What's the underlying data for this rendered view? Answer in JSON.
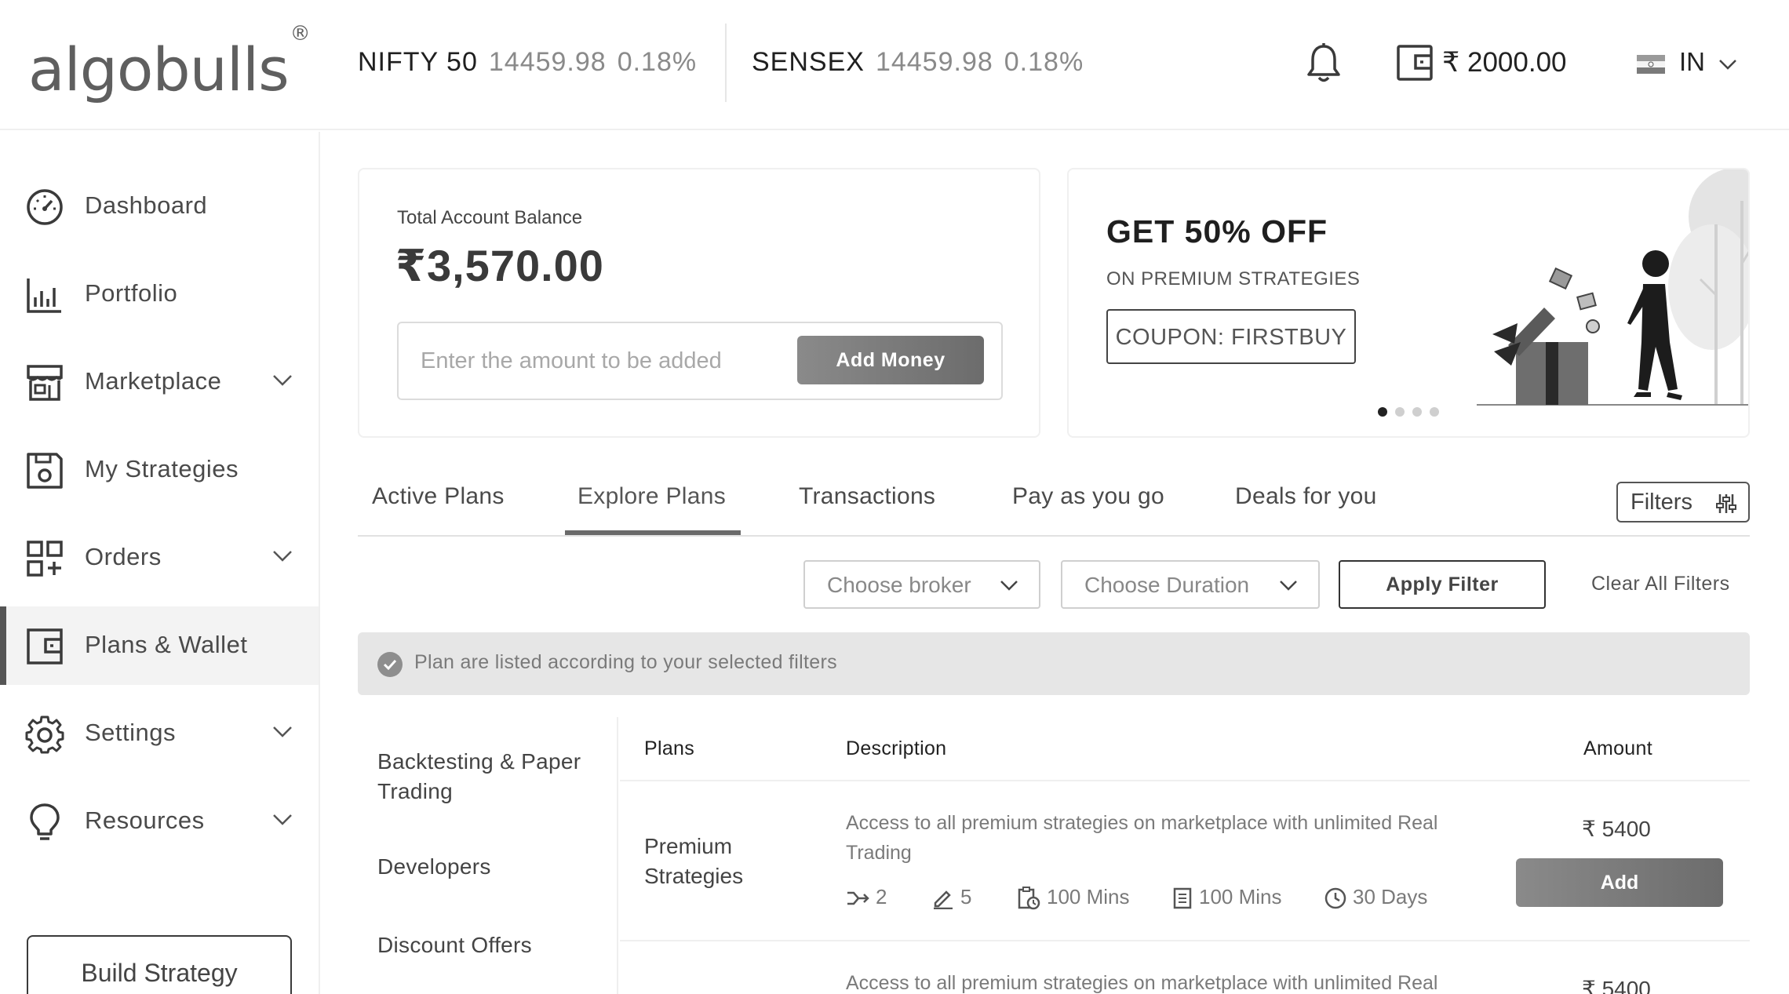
{
  "header": {
    "logo_text": "algobulls",
    "logo_mark": "®",
    "tickers": [
      {
        "name": "NIFTY 50",
        "value": "14459.98",
        "change": "0.18%"
      },
      {
        "name": "SENSEX",
        "value": "14459.98",
        "change": "0.18%"
      }
    ],
    "notification_icon": "bell-icon",
    "wallet_icon": "wallet-icon",
    "wallet_amount": "₹ 2000.00",
    "country_code": "IN"
  },
  "sidebar": {
    "items": [
      {
        "label": "Dashboard",
        "icon": "speedometer-icon"
      },
      {
        "label": "Portfolio",
        "icon": "bar-chart-icon"
      },
      {
        "label": "Marketplace",
        "icon": "store-icon"
      },
      {
        "label": "My Strategies",
        "icon": "save-icon"
      },
      {
        "label": "Orders",
        "icon": "grid-plus-icon"
      },
      {
        "label": "Plans & Wallet",
        "icon": "wallet-icon"
      },
      {
        "label": "Settings",
        "icon": "gear-icon"
      },
      {
        "label": "Resources",
        "icon": "lightbulb-icon"
      }
    ],
    "active_item": "Plans & Wallet",
    "build_button": "Build Strategy"
  },
  "balance_card": {
    "label": "Total Account Balance",
    "value": "₹3,570.00",
    "input_placeholder": "Enter the amount to be added",
    "add_button": "Add Money"
  },
  "promo_card": {
    "title": "GET 50% OFF",
    "subtitle": "ON PREMIUM STRATEGIES",
    "coupon": "COUPON: FIRSTBUY",
    "slide_count": 4,
    "active_slide": 1
  },
  "tabs": {
    "items": [
      "Active Plans",
      "Explore Plans",
      "Transactions",
      "Pay as you go",
      "Deals for you"
    ],
    "active": "Explore Plans",
    "filters_button": "Filters"
  },
  "filters": {
    "broker_placeholder": "Choose broker",
    "duration_placeholder": "Choose Duration",
    "apply_button": "Apply Filter",
    "clear_link": "Clear All Filters",
    "info_message": "Plan are listed according to your selected filters"
  },
  "categories": [
    "Backtesting & Paper Trading",
    "Developers",
    "Discount Offers"
  ],
  "table": {
    "headers": {
      "plans": "Plans",
      "description": "Description",
      "amount": "Amount"
    },
    "rows": [
      {
        "plan": "Premium Strategies",
        "description": "Access to all premium strategies on marketplace with unlimited Real Trading",
        "meta": [
          "2",
          "5",
          "100 Mins",
          "100 Mins",
          "30 Days"
        ],
        "amount": "₹ 5400",
        "button": "Add"
      },
      {
        "plan": "",
        "description": "Access to all premium strategies on marketplace with unlimited Real",
        "amount": "₹ 5400"
      }
    ]
  },
  "colors": {
    "accent": "#6c6c6c",
    "active_bg": "#f3f3f3",
    "info_bg": "#e6e6e6"
  }
}
